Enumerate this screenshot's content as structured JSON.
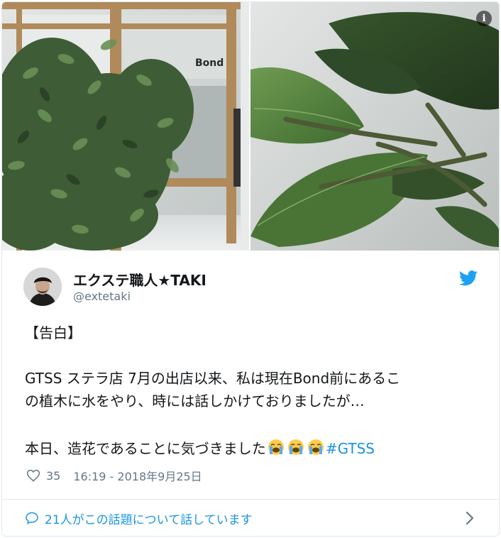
{
  "media": {
    "sign_text": "Bond",
    "info_glyph": "i"
  },
  "author": {
    "display_name": "エクステ職人★TAKI",
    "handle": "@extetaki"
  },
  "tweet": {
    "heading": "【告白】",
    "line1": "GTSS ステラ店 7月の出店以来、私は現在Bond前にあるこ",
    "line2": "の植木に水をやり、時には話しかけておりましたが…",
    "line3": "本日、造花であることに気づきました",
    "hashtag": "#GTSS"
  },
  "meta": {
    "likes": "35",
    "timestamp": "16:19 - 2018年9月25日"
  },
  "conversation": {
    "text": "21人がこの話題について話しています"
  },
  "icons": {
    "info": "info-icon",
    "logo": "twitter-bird-icon",
    "emoji": "loudly-crying-face-icon",
    "like": "heart-icon",
    "reply": "speech-bubble-icon",
    "next": "chevron-right-icon"
  },
  "colors": {
    "link": "#1b95e0",
    "muted": "#657786",
    "text": "#14171a",
    "border": "#e1e8ed"
  }
}
